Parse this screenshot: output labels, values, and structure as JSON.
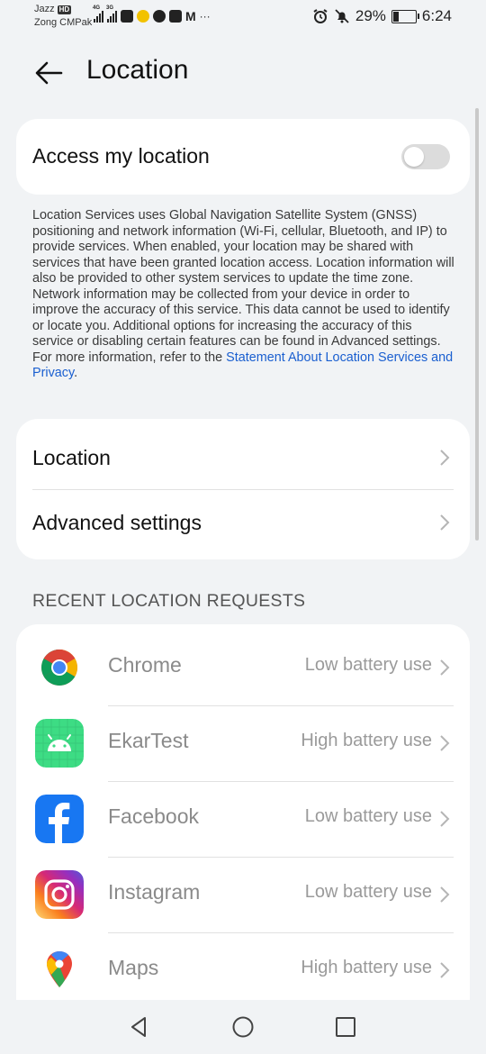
{
  "status_bar": {
    "carrier1": "Jazz",
    "carrier1_badge": "HD",
    "carrier2": "Zong CMPak",
    "net1": "4G",
    "net2": "3G",
    "battery": "29%",
    "battery_level": 0.29,
    "time": "6:24",
    "more": "···"
  },
  "header": {
    "title": "Location"
  },
  "access": {
    "label": "Access my location",
    "enabled": false
  },
  "description": {
    "text": "Location Services uses Global Navigation Satellite System (GNSS) positioning and network information (Wi-Fi, cellular, Bluetooth, and IP) to provide services. When enabled, your location may be shared with services that have been granted location access. Location information will also be provided to other system services to update the time zone. Network information may be collected from your device in order to improve the accuracy of this service. This data cannot be used to identify or locate you. Additional options for increasing the accuracy of this service or disabling certain features can be found in Advanced settings. For more information, refer to the ",
    "link": "Statement About Location Services and Privacy",
    "end": "."
  },
  "settings": {
    "location": "Location",
    "advanced": "Advanced settings"
  },
  "recent": {
    "header": "RECENT LOCATION REQUESTS",
    "apps": [
      {
        "name": "Chrome",
        "usage": "Low battery use",
        "icon": "chrome-icon"
      },
      {
        "name": "EkarTest",
        "usage": "High battery use",
        "icon": "android-icon"
      },
      {
        "name": "Facebook",
        "usage": "Low battery use",
        "icon": "facebook-icon"
      },
      {
        "name": "Instagram",
        "usage": "Low battery use",
        "icon": "instagram-icon"
      },
      {
        "name": "Maps",
        "usage": "High battery use",
        "icon": "maps-icon"
      }
    ]
  },
  "colors": {
    "background": "#f1f3f5",
    "link": "#1a5fd0",
    "toggle_off": "#dcdcdc"
  }
}
